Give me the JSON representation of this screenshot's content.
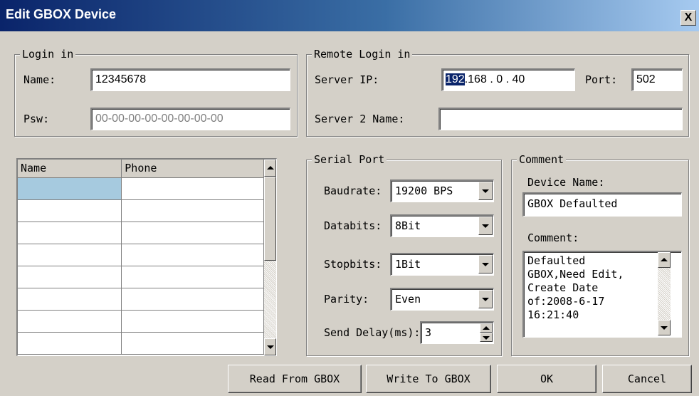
{
  "window": {
    "title": "Edit GBOX Device",
    "close_label": "X"
  },
  "login": {
    "legend": "Login in",
    "name_label": "Name:",
    "name_value": "12345678",
    "psw_label": "Psw:",
    "psw_value": "00-00-00-00-00-00-00-00"
  },
  "remote": {
    "legend": "Remote Login in",
    "server_ip_label": "Server IP:",
    "ip_octets": [
      "192",
      "168",
      "0",
      "40"
    ],
    "ip_dot": ".",
    "port_label": "Port:",
    "port_value": "502",
    "server2_label": "Server 2 Name:",
    "server2_value": ""
  },
  "phone_table": {
    "columns": [
      "Name",
      "Phone"
    ],
    "rows": [
      [
        "",
        ""
      ],
      [
        "",
        ""
      ],
      [
        "",
        ""
      ],
      [
        "",
        ""
      ],
      [
        "",
        ""
      ],
      [
        "",
        ""
      ],
      [
        "",
        ""
      ],
      [
        "",
        ""
      ]
    ]
  },
  "serial": {
    "legend": "Serial Port",
    "baudrate_label": "Baudrate:",
    "baudrate_value": "19200 BPS",
    "databits_label": "Databits:",
    "databits_value": "8Bit",
    "stopbits_label": "Stopbits:",
    "stopbits_value": "1Bit",
    "parity_label": "Parity:",
    "parity_value": "Even",
    "send_delay_label": "Send Delay(ms):",
    "send_delay_value": "3"
  },
  "comment": {
    "legend": "Comment",
    "device_name_label": "Device Name:",
    "device_name_value": "GBOX Defaulted",
    "comment_label": "Comment:",
    "comment_lines": [
      "Defaulted",
      "GBOX,Need Edit,",
      "Create Date",
      "of:2008-6-17",
      "16:21:40"
    ]
  },
  "buttons": {
    "read": "Read From GBOX",
    "write": "Write To GBOX",
    "ok": "OK",
    "cancel": "Cancel"
  }
}
